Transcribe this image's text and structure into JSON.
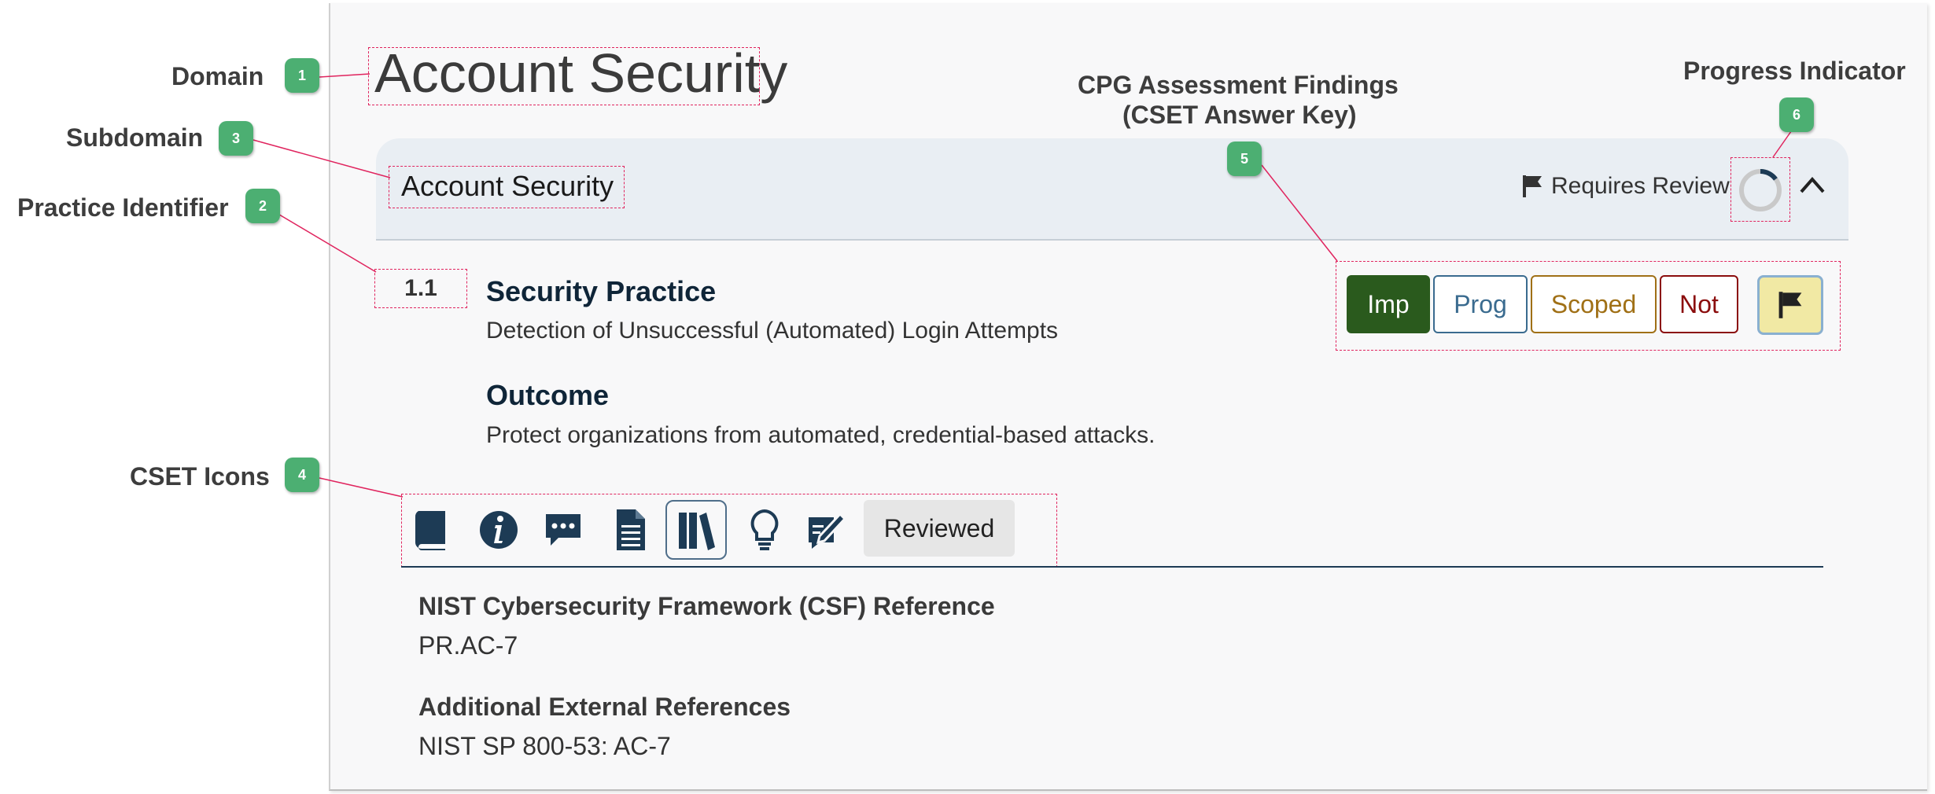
{
  "domain": {
    "title": "Account Security"
  },
  "subdomain": {
    "title": "Account Security",
    "review_label": "Requires Review",
    "progress": 0.15
  },
  "practice": {
    "id": "1.1",
    "security_heading": "Security Practice",
    "security_text": "Detection of Unsuccessful (Automated) Login Attempts",
    "outcome_heading": "Outcome",
    "outcome_text": "Protect organizations from automated, credential-based attacks."
  },
  "answers": {
    "imp": "Imp",
    "prog": "Prog",
    "scoped": "Scoped",
    "not": "Not"
  },
  "toolbar": {
    "icons": [
      "book-icon",
      "info-icon",
      "comments-icon",
      "document-icon",
      "library-icon",
      "lightbulb-icon",
      "observation-icon"
    ],
    "reviewed_label": "Reviewed"
  },
  "references": {
    "csf_heading": "NIST Cybersecurity Framework (CSF) Reference",
    "csf_value": "PR.AC-7",
    "external_heading": "Additional External References",
    "external_value": "NIST SP 800-53: AC-7"
  },
  "annotations": [
    {
      "number": "1",
      "label": "Domain"
    },
    {
      "number": "2",
      "label": "Practice Identifier"
    },
    {
      "number": "3",
      "label": "Subdomain"
    },
    {
      "number": "4",
      "label": "CSET Icons"
    },
    {
      "number": "5",
      "label_line1": "CPG Assessment Findings",
      "label_line2": "(CSET Answer Key)"
    },
    {
      "number": "6",
      "label": "Progress Indicator"
    }
  ],
  "colors": {
    "accent": "#e0245e",
    "badge": "#4caf72",
    "imp": "#2a5a1d",
    "prog": "#3a6b8f",
    "scoped": "#a07016",
    "not": "#8b0d0d",
    "navy": "#1d3b55"
  }
}
